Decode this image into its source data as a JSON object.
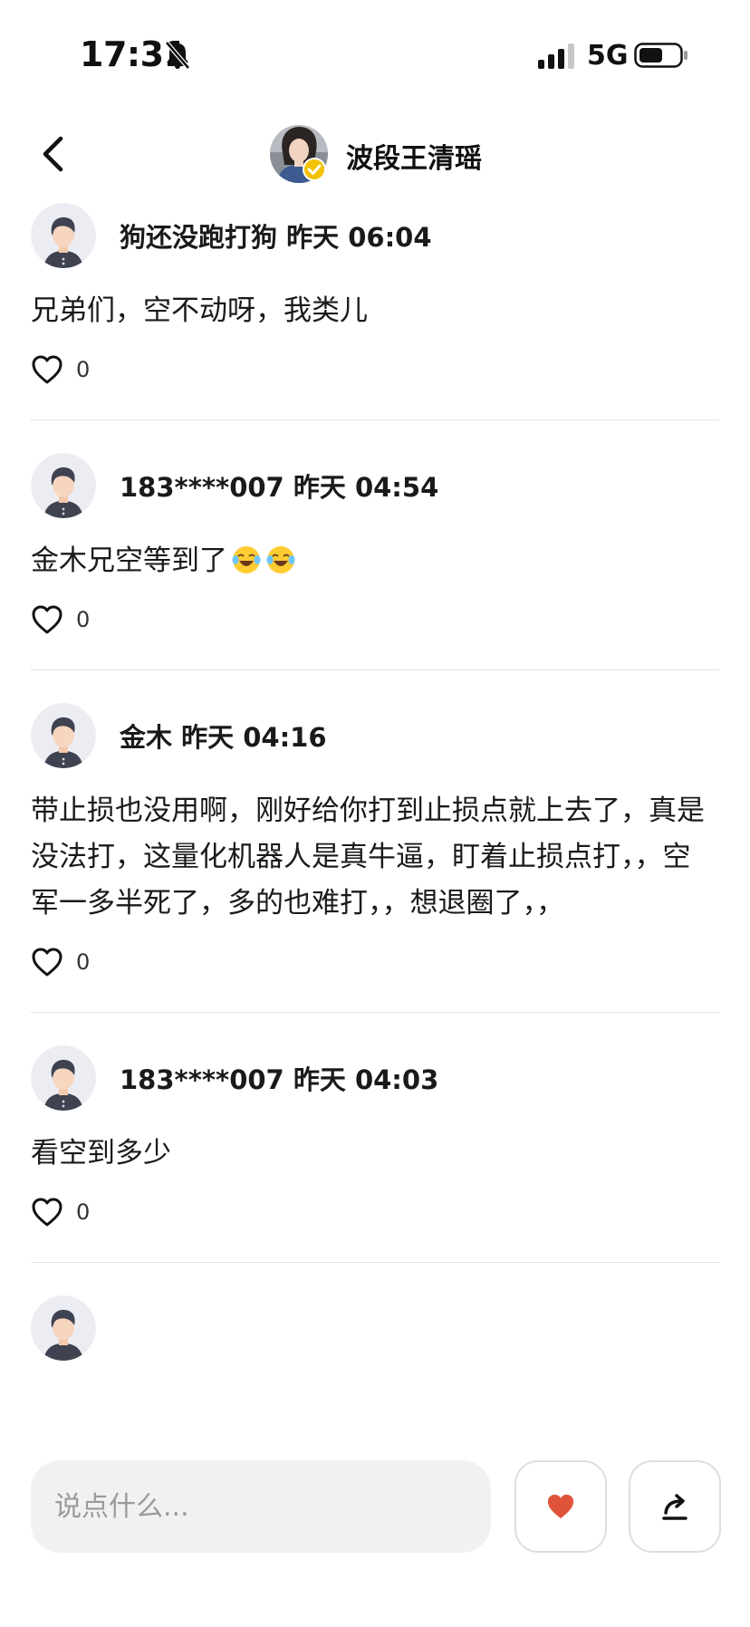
{
  "status_bar": {
    "time": "17:31",
    "network": "5G",
    "icons": [
      "bell-slash-icon",
      "signal-icon",
      "battery-icon"
    ]
  },
  "header": {
    "host_name": "波段王清瑶",
    "icons": [
      "back-arrow-icon",
      "verified-badge-icon"
    ]
  },
  "comments": [
    {
      "user": "狗还没跑打狗",
      "time": "昨天 06:04",
      "text": "兄弟们，空不动呀，我类儿",
      "likes": "0"
    },
    {
      "user": "183****007",
      "time": "昨天 04:54",
      "text": "金木兄空等到了",
      "emoji_count": 2,
      "likes": "0"
    },
    {
      "user": "金木",
      "time": "昨天 04:16",
      "text": "带止损也没用啊，刚好给你打到止损点就上去了，真是没法打，这量化机器人是真牛逼，盯着止损点打，，空军一多半死了，多的也难打，，想退圈了，，",
      "likes": "0"
    },
    {
      "user": "183****007",
      "time": "昨天 04:03",
      "text": "看空到多少",
      "likes": "0"
    }
  ],
  "bottom_bar": {
    "input_placeholder": "说点什么...",
    "icons": [
      "heart-icon",
      "share-icon"
    ],
    "accent_color": "#e0533b"
  }
}
